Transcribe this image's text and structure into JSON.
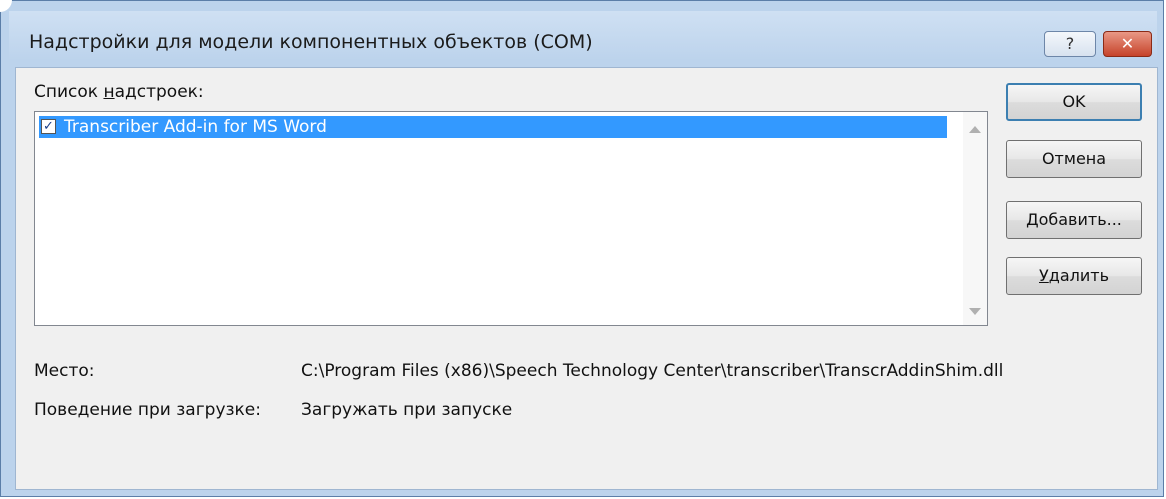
{
  "dialog": {
    "title": "Надстройки для модели компонентных объектов (COM)",
    "help_label": "?",
    "close_label": "✕"
  },
  "addins": {
    "label_prefix": "Список ",
    "label_mnemonic": "н",
    "label_rest": "адстроек:",
    "items": [
      {
        "label": "Transcriber Add-in for MS Word",
        "checked": true,
        "selected": true
      }
    ]
  },
  "buttons": {
    "ok": "OK",
    "cancel": "Отмена",
    "add_mnemonic": "Д",
    "add_rest": "обавить...",
    "remove_mnemonic": "У",
    "remove_rest": "далить"
  },
  "details": {
    "location_label": "Место:",
    "location_value": "C:\\Program Files (x86)\\Speech Technology Center\\transcriber\\TranscrAddinShim.dll",
    "load_behavior_label": "Поведение при загрузке:",
    "load_behavior_value": "Загружать при запуске"
  },
  "colors": {
    "selection": "#3399ff",
    "window_frame": "#bcd3ec",
    "client_bg": "#f0f0f0"
  }
}
